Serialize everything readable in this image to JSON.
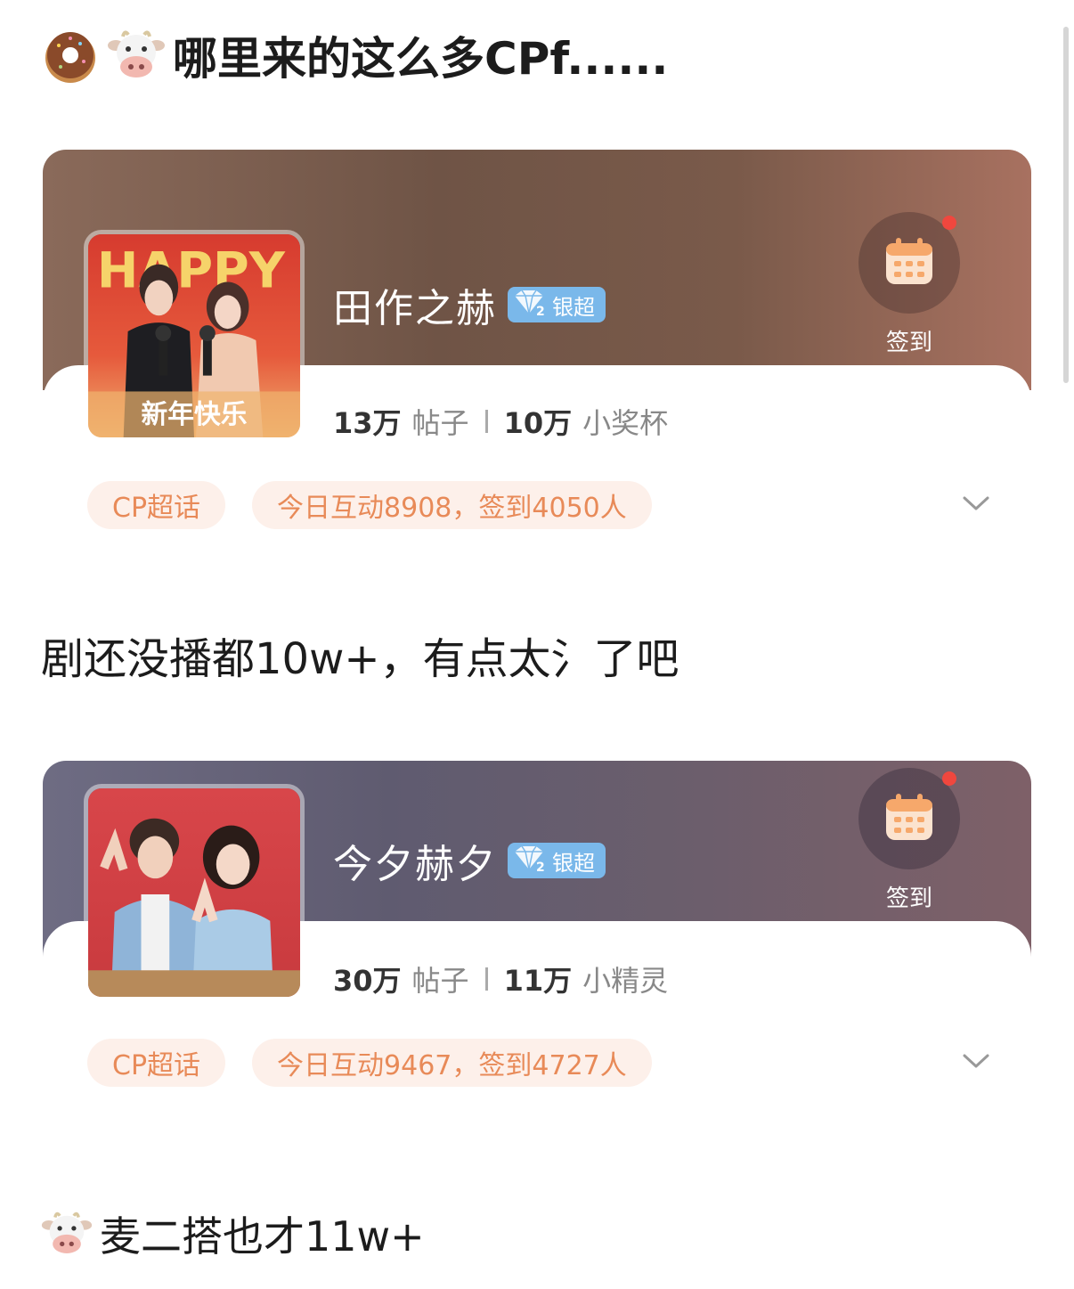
{
  "captions": {
    "top": "哪里来的这么多CPf......",
    "middle": "剧还没播都10w+，有点太氵了吧",
    "bottom": "麦二搭也才11w+"
  },
  "cards": [
    {
      "title": "田作之赫",
      "badge": "银超",
      "posts": "13万",
      "posts_label": "帖子",
      "second_stat": "10万",
      "second_label": "小奖杯",
      "tag1": "CP超话",
      "tag2": "今日互动8908，签到4050人",
      "checkin": "签到",
      "cover_text": "新年快乐"
    },
    {
      "title": "今夕赫夕",
      "badge": "银超",
      "posts": "30万",
      "posts_label": "帖子",
      "second_stat": "11万",
      "second_label": "小精灵",
      "tag1": "CP超话",
      "tag2": "今日互动9467，签到4727人",
      "checkin": "签到"
    }
  ],
  "icons": {
    "donut": "donut-emoji",
    "cow": "cow-face-emoji",
    "calendar": "calendar-icon",
    "diamond": "diamond-level-2-icon",
    "chevron": "chevron-down-icon"
  },
  "colors": {
    "tag_bg": "#fdf0ea",
    "tag_text": "#e88a58",
    "badge_bg": "#7ab8ea",
    "notify_dot": "#f0473e"
  }
}
